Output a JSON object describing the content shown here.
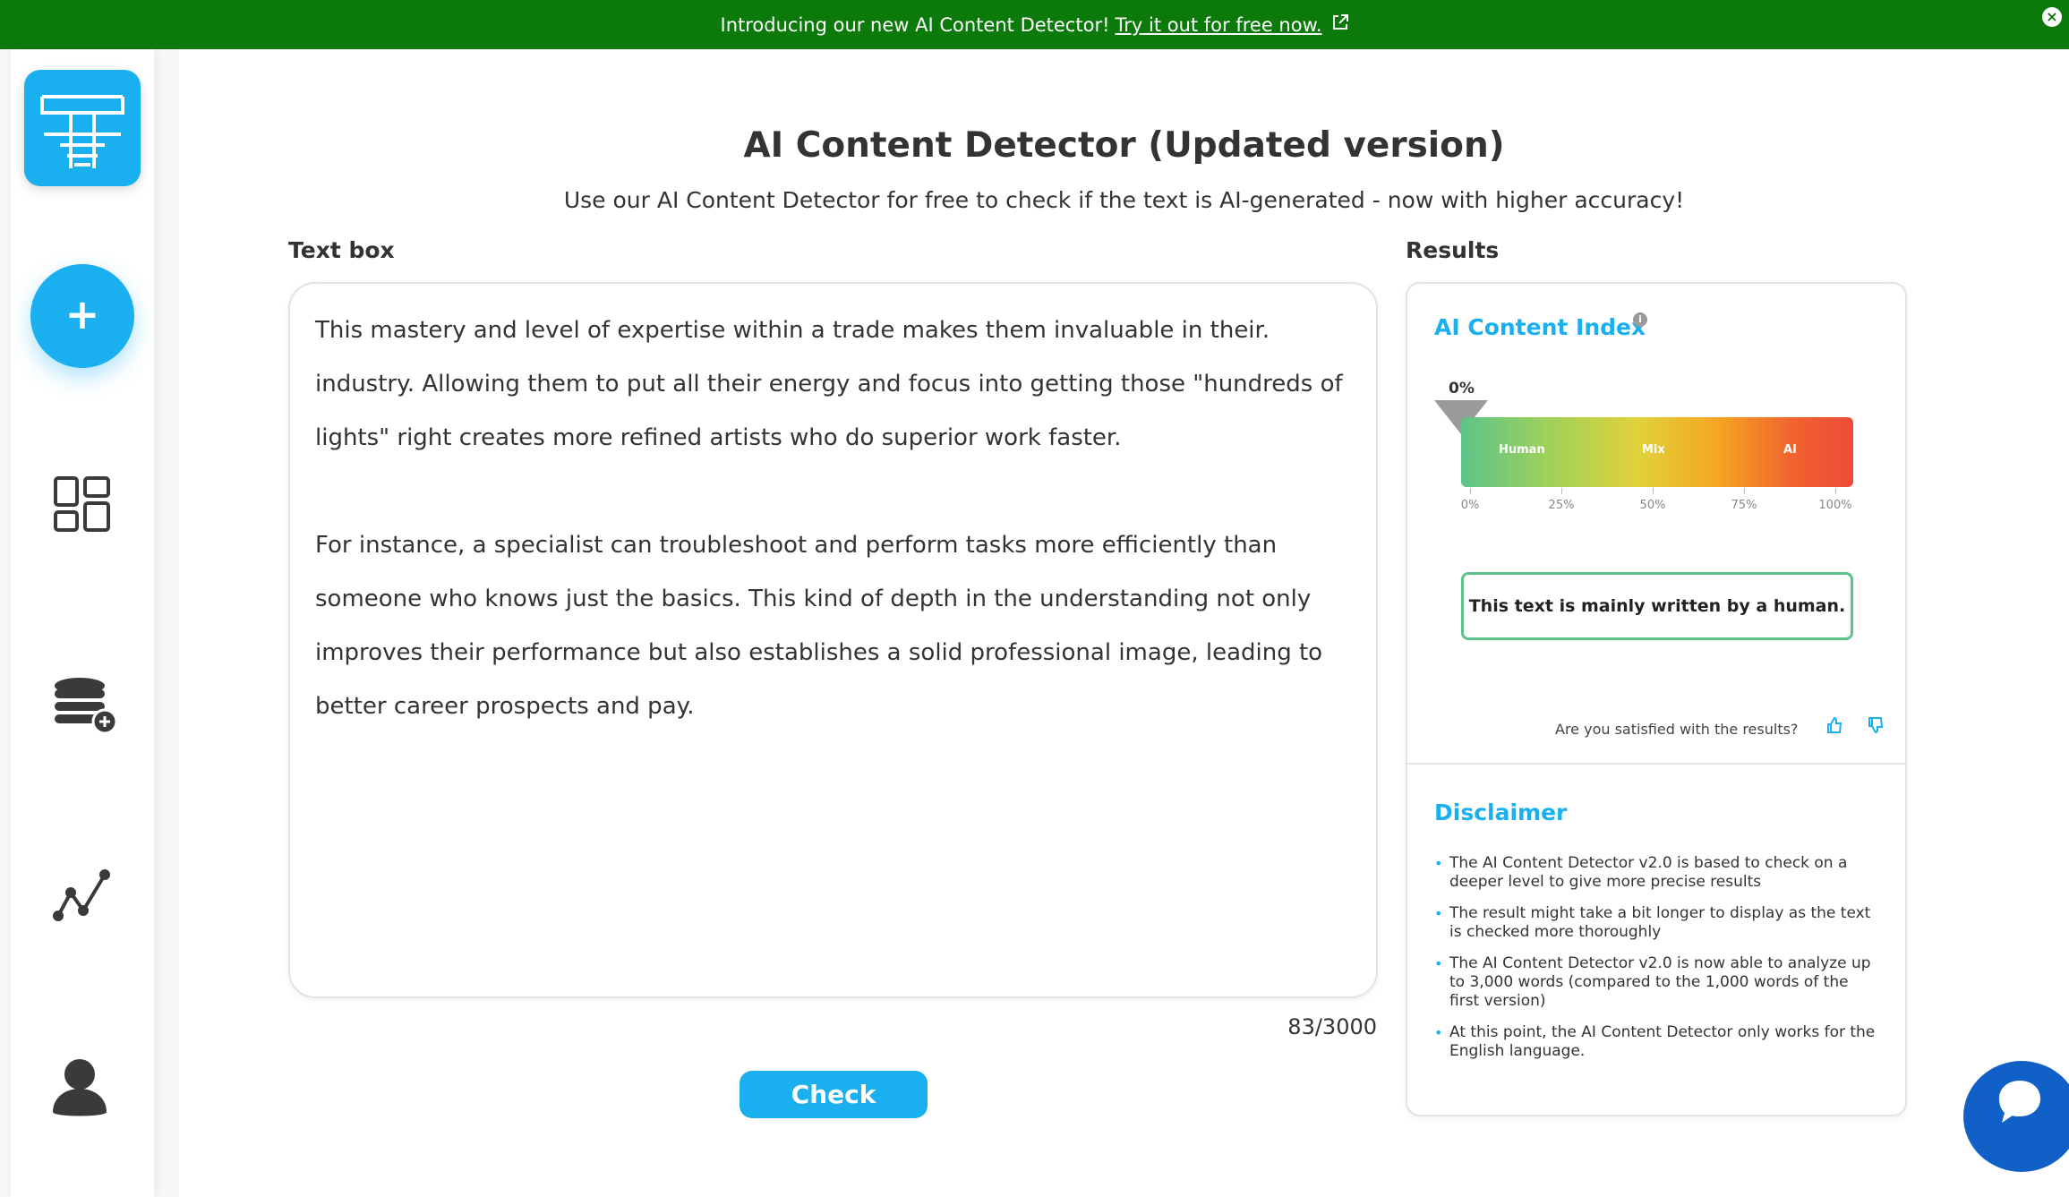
{
  "banner": {
    "text": "Introducing our new AI Content Detector!",
    "link": "Try it out for free now.",
    "ext_icon": "external-link-icon",
    "close_icon": "close-icon"
  },
  "sidebar": {
    "items": [
      {
        "name": "logo",
        "icon": "t-logo-icon"
      },
      {
        "name": "add",
        "label": "+"
      },
      {
        "name": "dashboard",
        "icon": "dashboard-grid-icon"
      },
      {
        "name": "credits",
        "icon": "coins-add-icon"
      },
      {
        "name": "stats",
        "icon": "line-chart-icon"
      },
      {
        "name": "account",
        "icon": "user-icon"
      }
    ]
  },
  "main": {
    "title": "AI Content Detector (Updated version)",
    "subtitle": "Use our AI Content Detector for free to check if the text is AI-generated - now with higher accuracy!",
    "textbox_label": "Text box",
    "results_label": "Results",
    "text_value": "This mastery and level of expertise within a trade makes them invaluable in their.\nindustry. Allowing them to put all their energy and focus into getting those \"hundreds of\nlights\" right creates more refined artists who do superior work faster.\n\nFor instance, a specialist can troubleshoot and perform tasks more efficiently than\nsomeone who knows just the basics. This kind of depth in the understanding not only\nimproves their performance but also establishes a solid professional image, leading to\nbetter career prospects and pay.",
    "counter": "83/3000",
    "check_label": "Check"
  },
  "results": {
    "index_title": "AI Content Index",
    "info_icon": "i",
    "pointer_value": "0%",
    "gauge_labels": {
      "human": "Human",
      "mix": "Mix",
      "ai": "AI"
    },
    "ticks": [
      "0%",
      "25%",
      "50%",
      "75%",
      "100%"
    ],
    "verdict": "This text is mainly written by a human.",
    "satisfied": "Are you satisfied with the results?",
    "thumb_up_icon": "thumbs-up-icon",
    "thumb_down_icon": "thumbs-down-icon",
    "disclaimer_title": "Disclaimer",
    "disclaimer": [
      "The AI Content Detector v2.0 is based to check on a deeper level to give more precise results",
      "The result might take a bit longer to display as the text is checked more thoroughly",
      "The AI Content Detector v2.0 is now able to analyze up to 3,000 words (compared to the 1,000 words of the first version)",
      "At this point, the AI Content Detector only works for the English language."
    ]
  },
  "colors": {
    "banner": "#0b7a0b",
    "accent": "#1ab0f0",
    "verdict_border": "#5cc48a",
    "chat": "#1060c8"
  }
}
